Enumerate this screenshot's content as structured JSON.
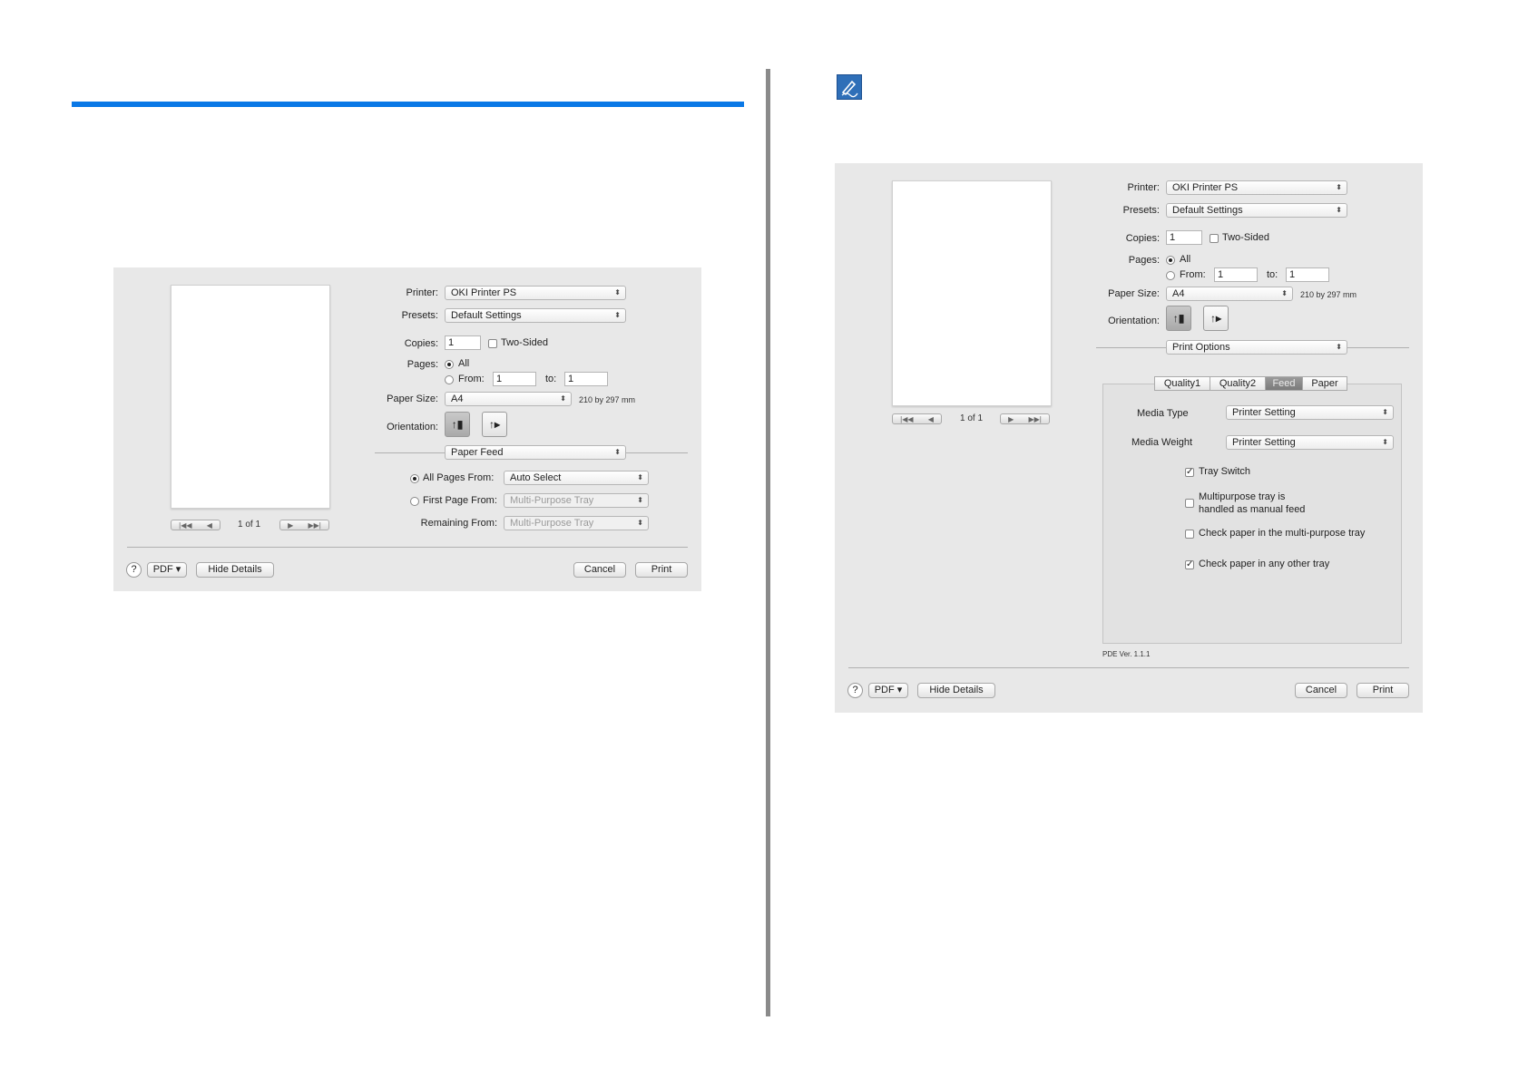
{
  "left_dialog": {
    "preview": {
      "page_count": "1 of 1"
    },
    "printer": {
      "label": "Printer:",
      "value": "OKI Printer PS"
    },
    "presets": {
      "label": "Presets:",
      "value": "Default Settings"
    },
    "copies": {
      "label": "Copies:",
      "value": "1",
      "two_sided": "Two-Sided"
    },
    "pages": {
      "label": "Pages:",
      "all": "All",
      "from": "From:",
      "from_value": "1",
      "to": "to:",
      "to_value": "1"
    },
    "paper_size": {
      "label": "Paper Size:",
      "value": "A4",
      "dims": "210 by 297 mm"
    },
    "orientation": {
      "label": "Orientation:"
    },
    "section": "Paper Feed",
    "feed": {
      "all_pages_from": "All Pages From:",
      "all_pages_value": "Auto Select",
      "first_page_from": "First Page From:",
      "first_page_value": "Multi-Purpose Tray",
      "remaining_from": "Remaining From:",
      "remaining_value": "Multi-Purpose Tray"
    },
    "footer": {
      "help": "?",
      "pdf": "PDF",
      "hide_details": "Hide Details",
      "cancel": "Cancel",
      "print": "Print"
    }
  },
  "right_dialog": {
    "preview": {
      "page_count": "1 of 1"
    },
    "printer": {
      "label": "Printer:",
      "value": "OKI Printer PS"
    },
    "presets": {
      "label": "Presets:",
      "value": "Default Settings"
    },
    "copies": {
      "label": "Copies:",
      "value": "1",
      "two_sided": "Two-Sided"
    },
    "pages": {
      "label": "Pages:",
      "all": "All",
      "from": "From:",
      "from_value": "1",
      "to": "to:",
      "to_value": "1"
    },
    "paper_size": {
      "label": "Paper Size:",
      "value": "A4",
      "dims": "210 by 297 mm"
    },
    "orientation": {
      "label": "Orientation:"
    },
    "section": "Print Options",
    "tabs": [
      "Quality1",
      "Quality2",
      "Feed",
      "Paper"
    ],
    "selected_tab": "Feed",
    "media_type": {
      "label": "Media Type",
      "value": "Printer Setting"
    },
    "media_weight": {
      "label": "Media Weight",
      "value": "Printer Setting"
    },
    "options": {
      "tray_switch": {
        "label": "Tray Switch",
        "checked": true
      },
      "manual_feed_line1": "Multipurpose tray is",
      "manual_feed_line2": "handled as manual feed",
      "check_mp": {
        "label": "Check paper in the multi-purpose tray",
        "checked": false
      },
      "check_other": {
        "label": "Check paper in any other tray",
        "checked": true
      }
    },
    "pde_version": "PDE Ver. 1.1.1",
    "footer": {
      "help": "?",
      "pdf": "PDF",
      "hide_details": "Hide Details",
      "cancel": "Cancel",
      "print": "Print"
    }
  },
  "colors": {
    "accent_rule": "#0a78e6",
    "note_icon": "#2f6fb8",
    "divider": "#8a8a8a"
  },
  "icons": {
    "note": "pencil-note-icon"
  }
}
